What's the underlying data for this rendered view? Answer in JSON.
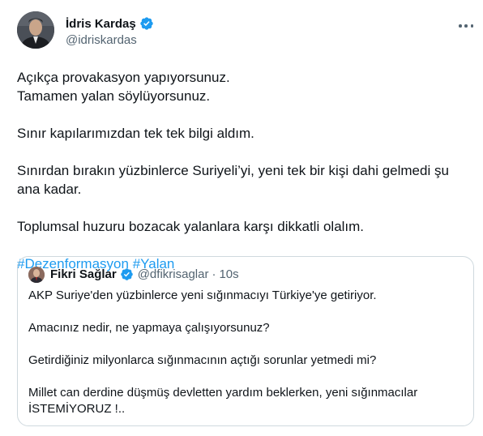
{
  "author": {
    "display_name": "İdris Kardaş",
    "handle": "@idriskardas",
    "verified_icon": "verified-badge-icon",
    "avatar_colors": {
      "bg": "#3b3f46",
      "face": "#c9a58a",
      "suit": "#1c1e22"
    }
  },
  "menu": {
    "icon": "more-options-icon"
  },
  "tweet": {
    "line1": "Açıkça provakasyon yapıyorsunuz.",
    "line2": "Tamamen yalan söylüyorsunuz.",
    "line3": "Sınır kapılarımızdan tek tek bilgi aldım.",
    "line4": "Sınırdan bırakın yüzbinlerce Suriyeli’yi, yeni tek bir kişi dahi gelmedi şu ana kadar.",
    "line5": "Toplumsal huzuru bozacak yalanlara karşı dikkatli olalım.",
    "hashtags": [
      "#Dezenformasyon",
      "#Yalan"
    ]
  },
  "quoted": {
    "display_name": "Fikri Sağlar",
    "handle": "@dfikrisaglar",
    "separator": "·",
    "time": "10s",
    "verified_icon": "verified-badge-icon",
    "line1": "AKP Suriye'den yüzbinlerce yeni sığınmacıyı Türkiye'ye getiriyor.",
    "line2": "Amacınız nedir, ne yapmaya çalışıyorsunuz?",
    "line3": "Getirdiğiniz milyonlarca sığınmacının açtığı sorunlar yetmedi mi?",
    "line4": "Millet can derdine düşmüş devletten yardım beklerken, yeni sığınmacılar İSTEMİYORUZ !.."
  },
  "colors": {
    "link": "#1d9bf0",
    "verified": "#1d9bf0",
    "muted": "#536471",
    "border": "#cfd9de"
  }
}
